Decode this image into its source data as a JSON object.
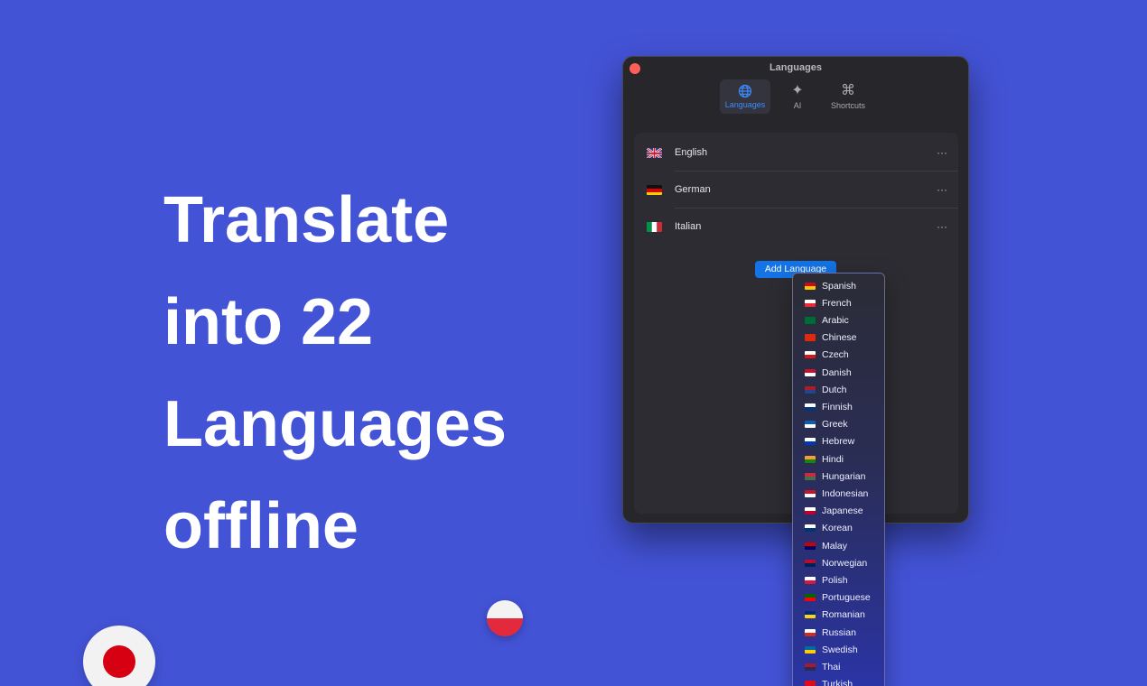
{
  "headline": {
    "lines": [
      "Translate",
      "into 22",
      "Languages",
      "offline"
    ]
  },
  "window": {
    "title": "Languages",
    "toolbar": [
      {
        "label": "Languages",
        "icon": "globe-icon",
        "active": true
      },
      {
        "label": "AI",
        "icon": "sparkles-icon",
        "active": false
      },
      {
        "label": "Shortcuts",
        "icon": "command-icon",
        "active": false
      }
    ],
    "languages": [
      {
        "name": "English",
        "flag": "uk-flag-icon"
      },
      {
        "name": "German",
        "flag": "germany-flag-icon"
      },
      {
        "name": "Italian",
        "flag": "italy-flag-icon"
      }
    ],
    "more_label": "···",
    "add_button_label": "Add Language"
  },
  "dropdown": {
    "options": [
      "Spanish",
      "French",
      "Arabic",
      "Chinese",
      "Czech",
      "Danish",
      "Dutch",
      "Finnish",
      "Greek",
      "Hebrew",
      "Hindi",
      "Hungarian",
      "Indonesian",
      "Japanese",
      "Korean",
      "Malay",
      "Norwegian",
      "Polish",
      "Portuguese",
      "Romanian",
      "Russian",
      "Swedish",
      "Thai",
      "Turkish"
    ]
  },
  "colors": {
    "background": "#4353d6",
    "accent": "#1473e6",
    "window": "#26262b",
    "close": "#ff5f57"
  }
}
